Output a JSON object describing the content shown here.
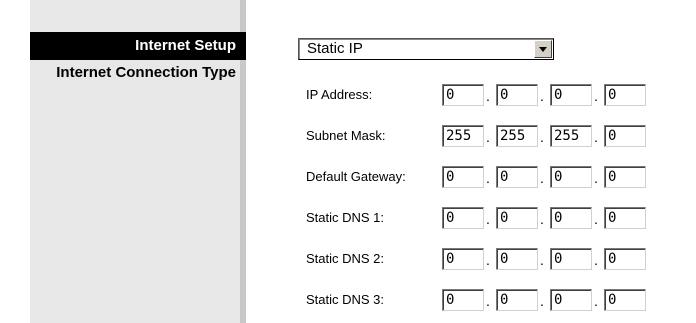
{
  "section": {
    "title": "Internet Setup",
    "label": "Internet Connection Type"
  },
  "connection_type": {
    "selected": "Static IP"
  },
  "fields": [
    {
      "label": "IP Address:",
      "octets": [
        "0",
        "0",
        "0",
        "0"
      ]
    },
    {
      "label": "Subnet Mask:",
      "octets": [
        "255",
        "255",
        "255",
        "0"
      ]
    },
    {
      "label": "Default Gateway:",
      "octets": [
        "0",
        "0",
        "0",
        "0"
      ]
    },
    {
      "label": "Static DNS 1:",
      "octets": [
        "0",
        "0",
        "0",
        "0"
      ]
    },
    {
      "label": "Static DNS 2:",
      "octets": [
        "0",
        "0",
        "0",
        "0"
      ]
    },
    {
      "label": "Static DNS 3:",
      "octets": [
        "0",
        "0",
        "0",
        "0"
      ]
    }
  ],
  "separator": "."
}
